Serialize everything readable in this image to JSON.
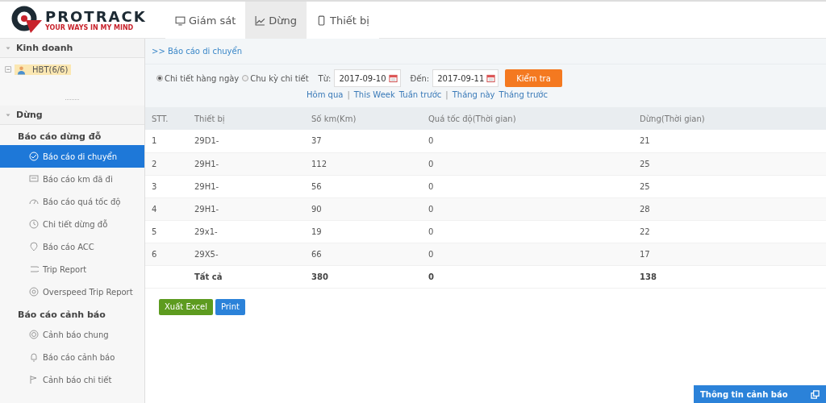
{
  "logo": {
    "name": "PROTRACK",
    "tagline": "YOUR WAYS IN MY MIND"
  },
  "nav": [
    {
      "label": "Giám sát",
      "selected": false
    },
    {
      "label": "Dừng",
      "selected": true
    },
    {
      "label": "Thiết bị",
      "selected": false
    }
  ],
  "sidebar": {
    "panels": [
      {
        "title": "Kinh doanh",
        "expanded": true,
        "tree": [
          {
            "label": "HBT(6/6)",
            "selected": true,
            "expanded": true
          }
        ]
      },
      {
        "title": "Dừng",
        "expanded": true,
        "groups": [
          {
            "title": "Báo cáo dừng đỗ",
            "items": [
              {
                "label": "Báo cáo di chuyển",
                "selected": true
              },
              {
                "label": "Báo cáo km đã đi",
                "selected": false
              },
              {
                "label": "Báo cáo quá tốc độ",
                "selected": false
              },
              {
                "label": "Chi tiết dừng đỗ",
                "selected": false
              },
              {
                "label": "Báo cáo ACC",
                "selected": false
              },
              {
                "label": "Trip Report",
                "selected": false
              },
              {
                "label": "Overspeed Trip Report",
                "selected": false
              }
            ]
          },
          {
            "title": "Báo cáo cảnh báo",
            "items": [
              {
                "label": "Cảnh báo chung",
                "selected": false
              },
              {
                "label": "Báo cáo cảnh báo",
                "selected": false
              },
              {
                "label": "Cảnh báo chi tiết",
                "selected": false
              }
            ]
          }
        ]
      }
    ]
  },
  "breadcrumb": ">> Báo cáo di chuyển",
  "filter": {
    "modes": [
      {
        "label": "Chi tiết hàng ngày",
        "selected": true
      },
      {
        "label": "Chu kỳ chi tiết",
        "selected": false
      }
    ],
    "from_label": "Từ:",
    "from": "2017-09-10",
    "to_label": "Đến:",
    "to": "2017-09-11",
    "button": "Kiểm tra",
    "quick_links": [
      "Hôm qua",
      "|",
      "This Week",
      "Tuần trước",
      "|",
      "Tháng này",
      "Tháng trước"
    ]
  },
  "table": {
    "columns": [
      "STT.",
      "Thiết bị",
      "Số km(Km)",
      "Quá tốc độ(Thời gian)",
      "Dừng(Thời gian)"
    ],
    "rows": [
      [
        "1",
        "29D1-",
        "37",
        "0",
        "21"
      ],
      [
        "2",
        "29H1-",
        "112",
        "0",
        "25"
      ],
      [
        "3",
        "29H1-",
        "56",
        "0",
        "25"
      ],
      [
        "4",
        "29H1-",
        "90",
        "0",
        "28"
      ],
      [
        "5",
        "29x1-",
        "19",
        "0",
        "22"
      ],
      [
        "6",
        "29X5-",
        "66",
        "0",
        "17"
      ]
    ],
    "total": {
      "label": "Tất cả",
      "values": [
        "380",
        "0",
        "138"
      ]
    }
  },
  "actions": [
    {
      "label": "Xuất Excel",
      "kind": "excel"
    },
    {
      "label": "Print",
      "kind": "print"
    }
  ],
  "alert_panel": {
    "title": "Thông tin cảnh báo"
  }
}
